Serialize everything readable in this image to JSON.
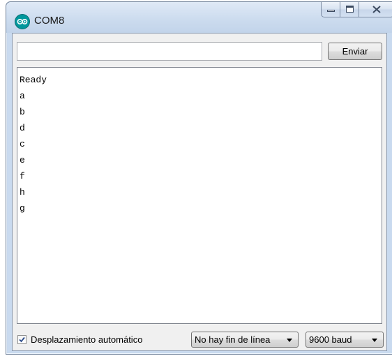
{
  "window": {
    "title": "COM8",
    "app_icon": "arduino-icon",
    "caption_icons": [
      "minimize-icon",
      "maximize-icon",
      "close-icon"
    ]
  },
  "send": {
    "input_value": "",
    "input_placeholder": "",
    "button_label": "Enviar"
  },
  "output": {
    "lines": [
      "Ready",
      "a",
      "b",
      "d",
      "c",
      "e",
      "f",
      "h",
      "g"
    ]
  },
  "status": {
    "autoscroll_label": "Desplazamiento automático",
    "autoscroll_checked": true,
    "line_ending": "No hay fin de línea",
    "baud_rate": "9600 baud"
  },
  "colors": {
    "arduino_teal": "#00979c",
    "frame": "#c9daef"
  }
}
